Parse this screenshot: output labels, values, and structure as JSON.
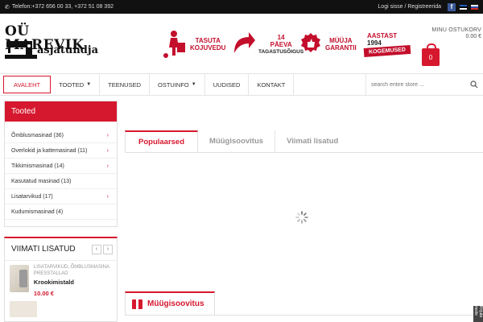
{
  "topbar": {
    "phone": "Telefon:+372 656 00 33, +372 51 08 392",
    "account_links": "Logi sisse / Registreerida"
  },
  "logo": {
    "line1": "OÜ MAREVIK",
    "line2": "asjatundja"
  },
  "promos": [
    {
      "line1": "TASUTA",
      "line2": "KOJUVEDU"
    },
    {
      "line1": "14",
      "line2": "PÄEVA",
      "line3": "TAGASTUSÕIGUS"
    },
    {
      "line1": "MÜÜJA",
      "line2": "GARANTII"
    },
    {
      "line1": "AASTAST",
      "line2": "1994",
      "line3": "KOGEMUSED"
    }
  ],
  "cart": {
    "label": "MINU OSTUKORV",
    "sum": "0.00 €",
    "count": "0"
  },
  "nav": {
    "items": [
      {
        "label": "AVALEHT"
      },
      {
        "label": "TOOTED"
      },
      {
        "label": "TEENUSED"
      },
      {
        "label": "OSTUINFO"
      },
      {
        "label": "UUDISED"
      },
      {
        "label": "KONTAKT"
      }
    ],
    "search_placeholder": "search entire store ..."
  },
  "categories": {
    "title": "Tooted",
    "items": [
      {
        "label": "Õmblusmasinad (36)"
      },
      {
        "label": "Overlokid ja kattemasinad (11)"
      },
      {
        "label": "Tikkimismasinad (14)"
      },
      {
        "label": "Kasutatud masinad (13)"
      },
      {
        "label": "Lisatarvikud (17)"
      },
      {
        "label": "Kudumismasinad (4)"
      }
    ]
  },
  "recent": {
    "title": "VIIMATI LISATUD",
    "product": {
      "category": "LISATARVIKUD, ÕMBLUSMASINA PRESSTALLAD",
      "name": "Krookimistald",
      "price": "10.00 €"
    }
  },
  "tabs": {
    "items": [
      {
        "label": "Populaarsed"
      },
      {
        "label": "Müügisoovitus"
      },
      {
        "label": "Viimati lisatud"
      }
    ]
  },
  "bottom_section": {
    "title": "Müügisoovitus"
  },
  "side_tab": "Kirjuta meile"
}
